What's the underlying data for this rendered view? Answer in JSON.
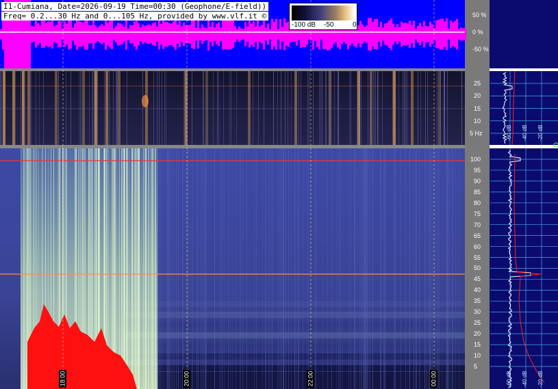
{
  "header": {
    "line1": "I1-Cumiana, Date=2026-09-19 Time=00:30 (Geophone/E-field))",
    "line2": "Freq= 0.2...30 Hz and 0...105 Hz, provided by www.vlf.it ©"
  },
  "colorbar": {
    "labels": [
      "-100 dB",
      "-50",
      "0"
    ]
  },
  "amplitude_panel": {
    "ticks": [
      "50 %",
      "0 %",
      "-50 %"
    ]
  },
  "low_freq_panel": {
    "ticks": [
      "25",
      "20",
      "15",
      "10",
      "5 Hz"
    ]
  },
  "high_freq_panel": {
    "ticks": [
      "100",
      "95",
      "90",
      "85",
      "80",
      "75",
      "70",
      "65",
      "60",
      "55",
      "50",
      "45",
      "40",
      "35",
      "30",
      "25",
      "20",
      "15",
      "10",
      "5"
    ]
  },
  "time_axis": {
    "labels": [
      "18:00",
      "20:00",
      "22:00",
      "00:00"
    ]
  },
  "spectrum_panel_top": {
    "db_labels": [
      "-60 dB",
      "-40 dB",
      "-20 dB"
    ]
  },
  "spectrum_panel_bottom": {
    "db_labels": [
      "-60 dB",
      "-40 dB",
      "-20 dB"
    ]
  },
  "colors": {
    "amplitude_fill": "#ff00ff",
    "amplitude_background": "#0000ff",
    "spectrogram_low": "#1a1a3c",
    "spectrogram_high": "#3a46a0",
    "spectrum_background": "#0b0b6e",
    "trace_white": "#ffffff",
    "trace_red": "#ff2020",
    "grid": "#4aa8e8",
    "ruler": "#888888"
  }
}
